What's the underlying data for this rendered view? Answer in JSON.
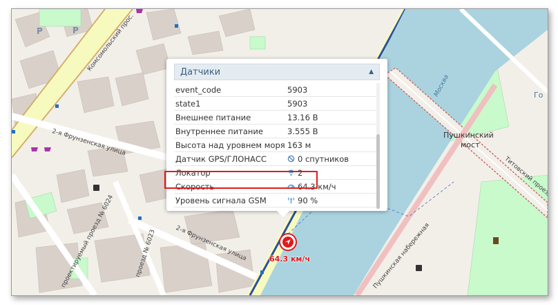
{
  "map": {
    "labels": {
      "bridge": "Пушкинский\nмост",
      "bridge_line1": "Пушкинский",
      "bridge_line2": "мост",
      "river": "Москва",
      "street_komsomolsky": "Комсомольский прос.",
      "street_frunzenskaya_top": "2-я Фрунзенская улица",
      "street_frunzenskaya_bottom": "2-я Фрунзенская улица",
      "passage_6024": "проектируемый проезд № 6024",
      "passage_6023": "проезд № 6023",
      "embankment_pushkin": "Пушкинская набережная",
      "embankment_titov": "Титовский проезд",
      "park_label": "Го"
    }
  },
  "popup": {
    "title": "Датчики",
    "rows": [
      {
        "name": "event_code",
        "value": "5903",
        "icon": ""
      },
      {
        "name": "state1",
        "value": "5903",
        "icon": ""
      },
      {
        "name": "Внешнее питание",
        "value": "13.16 В",
        "icon": ""
      },
      {
        "name": "Внутреннее питание",
        "value": "3.555 В",
        "icon": ""
      },
      {
        "name": "Высота над уровнем моря",
        "value": "163 м",
        "icon": ""
      },
      {
        "name": "Датчик GPS/ГЛОНАСС",
        "value": "0 спутников",
        "icon": "satellite-off-icon"
      },
      {
        "name": "Локатор",
        "value": "2",
        "icon": "wifi-icon"
      },
      {
        "name": "Скорость",
        "value": "64.3 км/ч",
        "icon": "speedometer-icon"
      },
      {
        "name": "Уровень сигнала GSM",
        "value": "90 %",
        "icon": "antenna-icon"
      }
    ]
  },
  "vehicle": {
    "speed_label": "64.3 км/ч"
  },
  "colors": {
    "accent": "#3a5f82",
    "highlight": "#e01b1b",
    "water": "#aad3df",
    "park": "#c8facc"
  }
}
